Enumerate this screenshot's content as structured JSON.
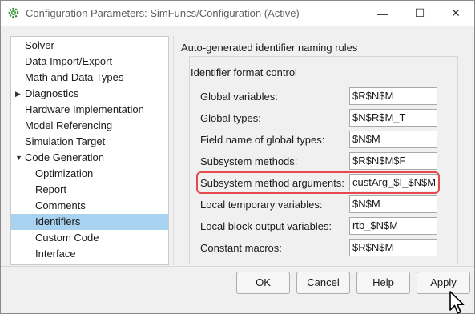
{
  "window": {
    "title": "Configuration Parameters: SimFuncs/Configuration (Active)",
    "minimize_glyph": "—",
    "maximize_glyph": "☐",
    "close_glyph": "✕",
    "app_icon": "gear-icon"
  },
  "tree": {
    "items": [
      {
        "label": "Solver",
        "level": 0,
        "expandable": false
      },
      {
        "label": "Data Import/Export",
        "level": 0,
        "expandable": false
      },
      {
        "label": "Math and Data Types",
        "level": 0,
        "expandable": false
      },
      {
        "label": "Diagnostics",
        "level": 0,
        "expandable": true,
        "expanded": false
      },
      {
        "label": "Hardware Implementation",
        "level": 0,
        "expandable": false
      },
      {
        "label": "Model Referencing",
        "level": 0,
        "expandable": false
      },
      {
        "label": "Simulation Target",
        "level": 0,
        "expandable": false
      },
      {
        "label": "Code Generation",
        "level": 0,
        "expandable": true,
        "expanded": true
      },
      {
        "label": "Optimization",
        "level": 1,
        "expandable": false
      },
      {
        "label": "Report",
        "level": 1,
        "expandable": false
      },
      {
        "label": "Comments",
        "level": 1,
        "expandable": false
      },
      {
        "label": "Identifiers",
        "level": 1,
        "expandable": false,
        "selected": true
      },
      {
        "label": "Custom Code",
        "level": 1,
        "expandable": false
      },
      {
        "label": "Interface",
        "level": 1,
        "expandable": false
      }
    ],
    "collapsed_arrow": "▶",
    "expanded_arrow": "▼"
  },
  "panel": {
    "section_title": "Auto-generated identifier naming rules",
    "group_title": "Identifier format control",
    "rows": [
      {
        "label": "Global variables:",
        "value": "$R$N$M"
      },
      {
        "label": "Global types:",
        "value": "$N$R$M_T"
      },
      {
        "label": "Field name of global types:",
        "value": "$N$M"
      },
      {
        "label": "Subsystem methods:",
        "value": "$R$N$M$F"
      },
      {
        "label": "Subsystem method arguments:",
        "value": "custArg_$I_$N$M",
        "highlighted": true
      },
      {
        "label": "Local temporary variables:",
        "value": "$N$M"
      },
      {
        "label": "Local block output variables:",
        "value": "rtb_$N$M"
      },
      {
        "label": "Constant macros:",
        "value": "$R$N$M"
      }
    ],
    "highlight_color": "#e5484d"
  },
  "buttons": {
    "ok": "OK",
    "cancel": "Cancel",
    "help": "Help",
    "apply": "Apply"
  },
  "colors": {
    "selection": "#a7d3f0",
    "background": "#f0f0f0"
  }
}
